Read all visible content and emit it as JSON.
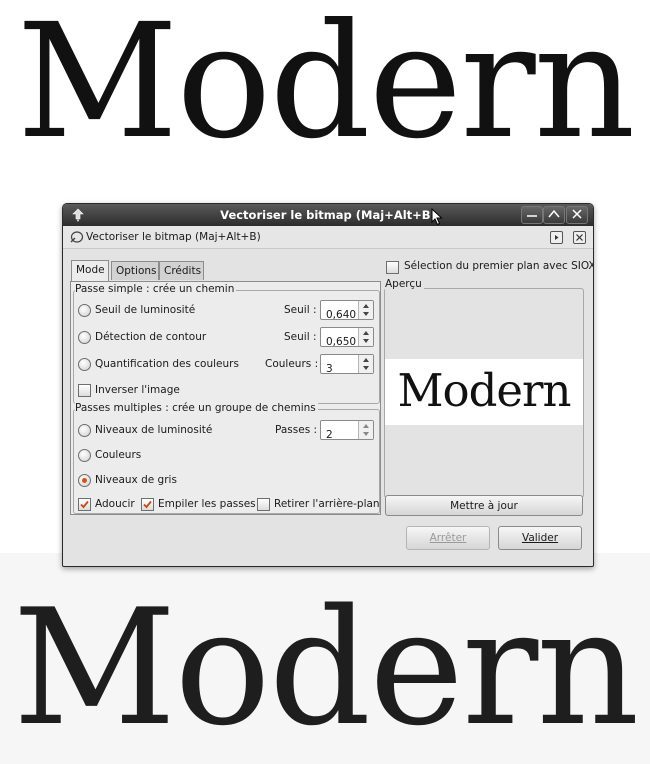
{
  "banner_top": {
    "text": "Modern"
  },
  "banner_bottom": {
    "text": "Modern"
  },
  "window": {
    "title": "Vectoriser le bitmap (Maj+Alt+B)",
    "dock_title": "Vectoriser le bitmap (Maj+Alt+B)"
  },
  "tabs": [
    {
      "label": "Mode",
      "active": true
    },
    {
      "label": "Options",
      "active": false
    },
    {
      "label": "Crédits",
      "active": false
    }
  ],
  "single_pass": {
    "group_title": "Passe simple : crée un chemin",
    "rows": [
      {
        "label": "Seuil de luminosité",
        "field_label": "Seuil :",
        "value": "0,640",
        "selected": false
      },
      {
        "label": "Détection de contour",
        "field_label": "Seuil :",
        "value": "0,650",
        "selected": false
      },
      {
        "label": "Quantification des couleurs",
        "field_label": "Couleurs :",
        "value": "3",
        "selected": false
      }
    ],
    "invert_label": "Inverser l'image",
    "invert_checked": false
  },
  "multi_pass": {
    "group_title": "Passes multiples : crée un groupe de chemins",
    "rows": [
      {
        "label": "Niveaux de luminosité",
        "field_label": "Passes :",
        "value": "2",
        "selected": false
      },
      {
        "label": "Couleurs",
        "selected": false
      },
      {
        "label": "Niveaux de gris",
        "selected": true
      }
    ],
    "options": [
      {
        "label": "Adoucir",
        "checked": true
      },
      {
        "label": "Empiler les passes",
        "checked": true
      },
      {
        "label": "Retirer l'arrière-plan",
        "checked": false
      }
    ]
  },
  "siox": {
    "label": "Sélection du premier plan avec SIOX",
    "checked": false
  },
  "preview": {
    "title": "Aperçu",
    "sample_text": "Modern"
  },
  "buttons": {
    "update": "Mettre à jour",
    "stop": "Arrêter",
    "ok": "Valider"
  },
  "colors": {
    "accent_radio": "#d8501e",
    "check_mark": "#c24a16"
  }
}
